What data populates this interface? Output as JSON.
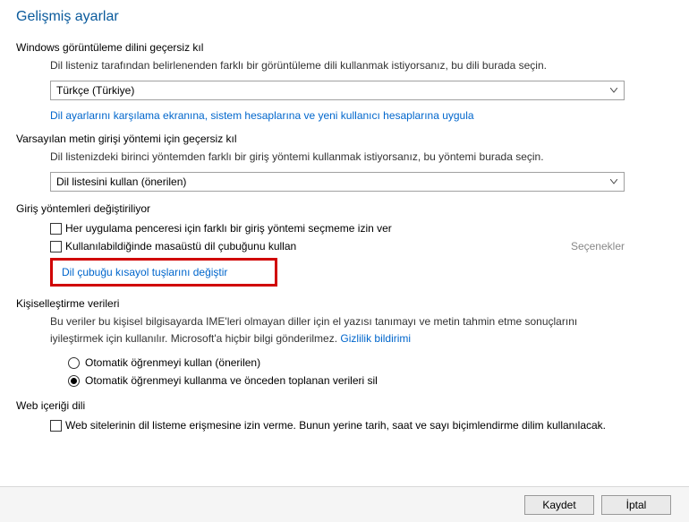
{
  "page_title": "Gelişmiş ayarlar",
  "s1": {
    "heading": "Windows görüntüleme dilini geçersiz kıl",
    "desc": "Dil listeniz tarafından belirlenenden farklı bir görüntüleme dili kullanmak istiyorsanız, bu dili burada seçin.",
    "dropdown": "Türkçe (Türkiye)",
    "link": "Dil ayarlarını karşılama ekranına, sistem hesaplarına ve yeni kullanıcı hesaplarına uygula"
  },
  "s2": {
    "heading": "Varsayılan metin girişi yöntemi için geçersiz kıl",
    "desc": "Dil listenizdeki birinci yöntemden farklı bir giriş yöntemi kullanmak istiyorsanız, bu yöntemi burada seçin.",
    "dropdown": "Dil listesini kullan (önerilen)"
  },
  "s3": {
    "heading": "Giriş yöntemleri değiştiriliyor",
    "cb1": "Her uygulama penceresi için farklı bir giriş yöntemi seçmeme izin ver",
    "cb2": "Kullanılabildiğinde masaüstü dil çubuğunu kullan",
    "options": "Seçenekler",
    "link": "Dil çubuğu kısayol tuşlarını değiştir"
  },
  "s4": {
    "heading": "Kişiselleştirme verileri",
    "desc_pre": "Bu veriler bu kişisel bilgisayarda IME'leri olmayan diller için el yazısı tanımayı ve metin tahmin etme sonuçlarını iyileştirmek için kullanılır. Microsoft'a hiçbir bilgi gönderilmez. ",
    "privacy_link": "Gizlilik bildirimi",
    "r1": "Otomatik öğrenmeyi kullan (önerilen)",
    "r2": "Otomatik öğrenmeyi kullanma ve önceden toplanan verileri sil"
  },
  "s5": {
    "heading": "Web içeriği dili",
    "cb1": "Web sitelerinin dil listeme erişmesine izin verme. Bunun yerine tarih, saat ve sayı biçimlendirme dilim kullanılacak."
  },
  "footer": {
    "save": "Kaydet",
    "cancel": "İptal"
  }
}
